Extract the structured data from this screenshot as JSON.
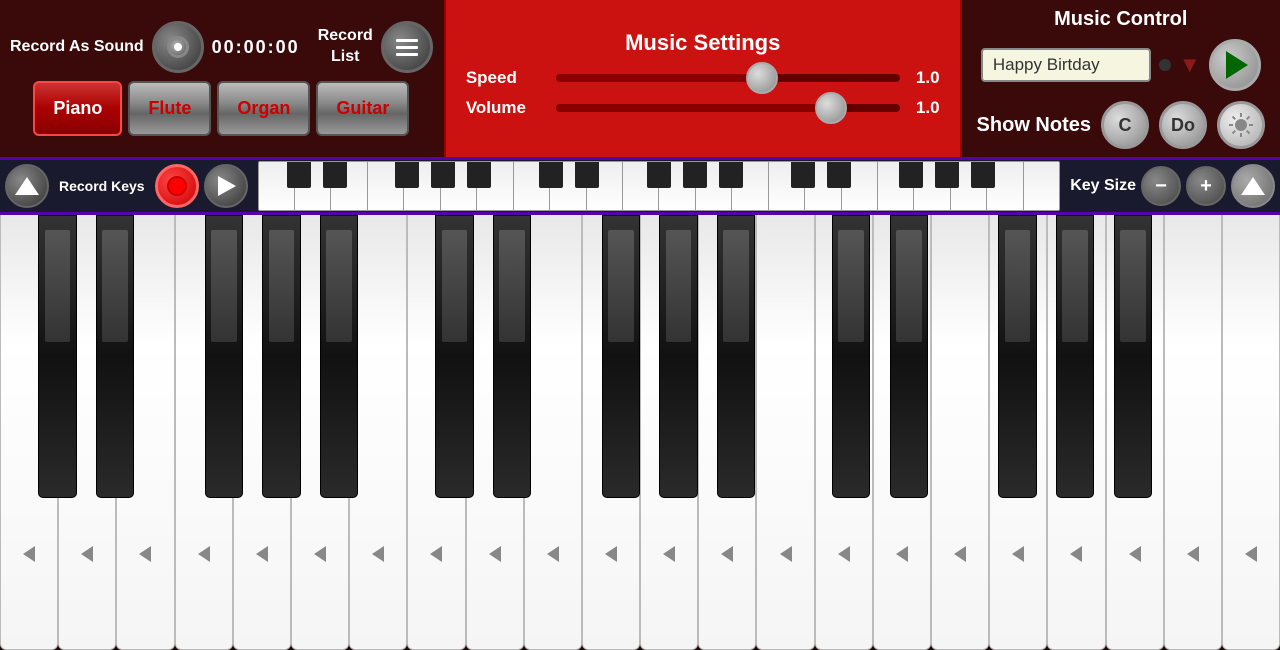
{
  "header": {
    "record_as_sound": "Record\nAs Sound",
    "timer": "00:00:00",
    "record_list": "Record\nList",
    "music_settings_title": "Music Settings",
    "speed_label": "Speed",
    "speed_value": "1.0",
    "volume_label": "Volume",
    "volume_value": "1.0",
    "speed_percent": 60,
    "volume_percent": 80,
    "music_control_title": "Music Control",
    "song_name": "Happy Birtday",
    "show_notes_label": "Show Notes",
    "note_c": "C",
    "note_do": "Do"
  },
  "controls": {
    "record_keys_label": "Record\nKeys",
    "key_size_label": "Key Size"
  },
  "instruments": [
    {
      "label": "Piano",
      "active": true
    },
    {
      "label": "Flute",
      "active": false
    },
    {
      "label": "Organ",
      "active": false
    },
    {
      "label": "Guitar",
      "active": false
    }
  ],
  "piano": {
    "white_keys_count": 22,
    "octaves": 3
  }
}
